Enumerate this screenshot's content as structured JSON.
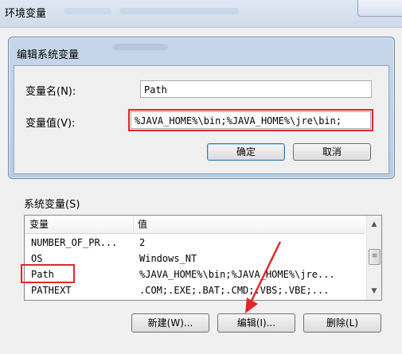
{
  "outer_window": {
    "title": "环境变量"
  },
  "dialog": {
    "title": "编辑系统变量",
    "name_label": "变量名(N):",
    "name_value": "Path",
    "value_label": "变量值(V):",
    "value_value": "%JAVA_HOME%\\bin;%JAVA_HOME%\\jre\\bin;",
    "ok_label": "确定",
    "cancel_label": "取消"
  },
  "system_variables": {
    "label": "系统变量(S)",
    "columns": [
      "变量",
      "值"
    ],
    "rows": [
      {
        "name": "NUMBER_OF_PR...",
        "value": "2"
      },
      {
        "name": "OS",
        "value": "Windows_NT"
      },
      {
        "name": "Path",
        "value": "%JAVA_HOME%\\bin;%JAVA_HOME%\\jre..."
      },
      {
        "name": "PATHEXT",
        "value": ".COM;.EXE;.BAT;.CMD;.VBS;.VBE;..."
      }
    ],
    "new_label": "新建(W)...",
    "edit_label": "编辑(I)...",
    "delete_label": "删除(L)"
  },
  "colors": {
    "highlight": "#e3262a"
  }
}
